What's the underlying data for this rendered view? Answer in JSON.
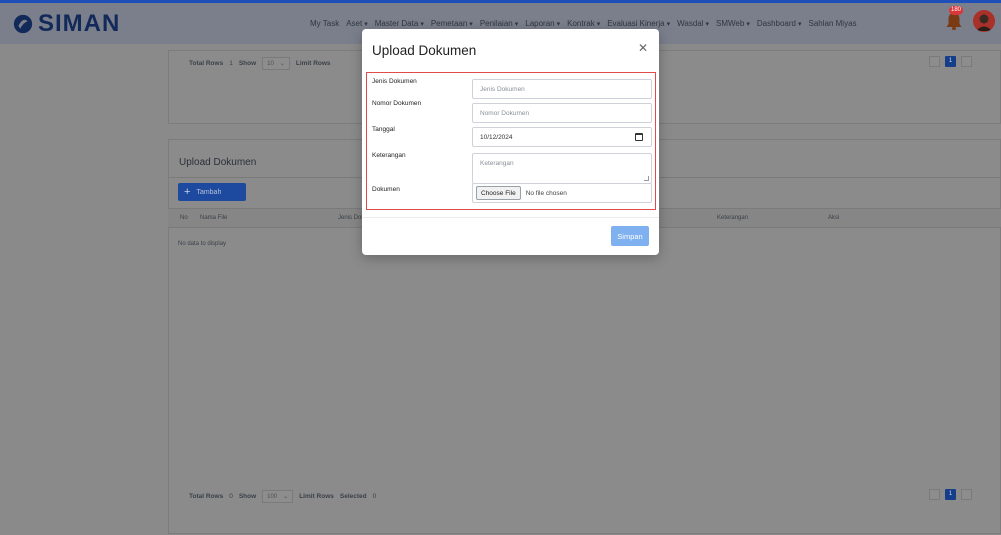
{
  "app": {
    "brand": "SIMAN",
    "colors": {
      "brand_blue": "#1e4fb8",
      "nav_bg": "#7b7f8c",
      "danger": "#e04b4b",
      "primary_light": "#7fb0f0"
    }
  },
  "nav": {
    "items": [
      {
        "label": "My Task",
        "dropdown": false
      },
      {
        "label": "Aset",
        "dropdown": true
      },
      {
        "label": "Master Data",
        "dropdown": true
      },
      {
        "label": "Pemetaan",
        "dropdown": true
      },
      {
        "label": "Penilaian",
        "dropdown": true
      },
      {
        "label": "Laporan",
        "dropdown": true
      },
      {
        "label": "Kontrak",
        "dropdown": true
      },
      {
        "label": "Evaluasi Kinerja",
        "dropdown": true
      },
      {
        "label": "Wasdal",
        "dropdown": true
      },
      {
        "label": "SMWeb",
        "dropdown": true
      },
      {
        "label": "Dashboard",
        "dropdown": true
      },
      {
        "label": "Sahlan Miyas",
        "dropdown": false
      }
    ],
    "notification_count": "180"
  },
  "top_panel": {
    "total_rows_label": "Total Rows",
    "total_rows_value": "1",
    "show_label": "Show",
    "show_value": "10",
    "limit_label": "Limit Rows",
    "current_page": "1"
  },
  "main_panel": {
    "title": "Upload Dokumen",
    "add_button": "Tambah",
    "columns": [
      "No",
      "Nama File",
      "Jenis Dokumen",
      "Keterangan",
      "Aksi"
    ],
    "empty_text": "No data to display",
    "total_rows_label": "Total Rows",
    "total_rows_value": "0",
    "show_label": "Show",
    "show_value": "100",
    "limit_label": "Limit Rows",
    "selected_label": "Selected",
    "selected_value": "0",
    "current_page": "1"
  },
  "modal": {
    "title": "Upload Dokumen",
    "close_icon": "close-icon",
    "fields": {
      "jenis_label": "Jenis Dokumen",
      "jenis_placeholder": "Jenis Dokumen",
      "nomor_label": "Nomor Dokumen",
      "nomor_placeholder": "Nomor Dokumen",
      "tanggal_label": "Tanggal",
      "tanggal_value": "10/12/2024",
      "keterangan_label": "Keterangan",
      "keterangan_placeholder": "Keterangan",
      "dokumen_label": "Dokumen",
      "file_button": "Choose File",
      "file_status": "No file chosen"
    },
    "save_button": "Simpan"
  }
}
